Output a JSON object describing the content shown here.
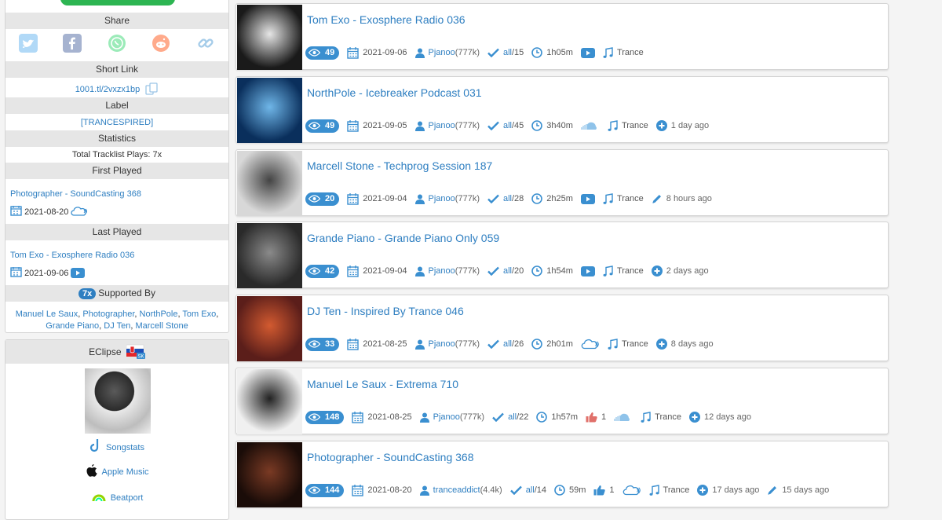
{
  "sidebar": {
    "share_title": "Share",
    "share_icons": [
      "twitter-icon",
      "facebook-icon",
      "whatsapp-icon",
      "reddit-icon",
      "link-icon"
    ],
    "short_link_title": "Short Link",
    "short_link": "1001.tl/2vxzx1bp",
    "label_title": "Label",
    "label_value": "[TRANCESPIRED]",
    "statistics_title": "Statistics",
    "total_plays": "Total Tracklist Plays: 7x",
    "first_played_title": "First Played",
    "first_played": {
      "name": "Photographer - SoundCasting 368",
      "date": "2021-08-20"
    },
    "last_played_title": "Last Played",
    "last_played": {
      "name": "Tom Exo - Exosphere Radio 036",
      "date": "2021-09-06"
    },
    "supported_badge": "7x",
    "supported_title": "Supported By",
    "supporters": [
      "Manuel Le Saux",
      "Photographer",
      "NorthPole",
      "Tom Exo",
      "Grande Piano",
      "DJ Ten",
      "Marcell Stone"
    ],
    "artist_name": "EClipse",
    "flag_badge": "SK",
    "links": [
      "Songstats",
      "Apple Music",
      "Beatport"
    ]
  },
  "tracklists": [
    {
      "title": "Tom Exo - Exosphere Radio 036",
      "views": "49",
      "date": "2021-09-06",
      "user": "Pjanoo",
      "user_count": "(777k)",
      "ids": "all",
      "ids_total": "/15",
      "duration": "1h05m",
      "media": "youtube",
      "genre": "Trance",
      "extra": "",
      "thumb": [
        "#1a1a1a",
        "#e6e6e6"
      ]
    },
    {
      "title": "NorthPole - Icebreaker Podcast 031",
      "views": "49",
      "date": "2021-09-05",
      "user": "Pjanoo",
      "user_count": "(777k)",
      "ids": "all",
      "ids_total": "/45",
      "duration": "3h40m",
      "media": "soundcloud",
      "genre": "Trance",
      "extra": "1 day ago",
      "extra_icon": "plus",
      "thumb": [
        "#0a2f5c",
        "#6fb6e8"
      ]
    },
    {
      "title": "Marcell Stone - Techprog Session 187",
      "views": "20",
      "date": "2021-09-04",
      "user": "Pjanoo",
      "user_count": "(777k)",
      "ids": "all",
      "ids_total": "/28",
      "duration": "2h25m",
      "media": "youtube",
      "genre": "Trance",
      "extra": "8 hours ago",
      "extra_icon": "pencil",
      "thumb": [
        "#d8d8d8",
        "#444444"
      ]
    },
    {
      "title": "Grande Piano - Grande Piano Only 059",
      "views": "42",
      "date": "2021-09-04",
      "user": "Pjanoo",
      "user_count": "(777k)",
      "ids": "all",
      "ids_total": "/20",
      "duration": "1h54m",
      "media": "youtube",
      "genre": "Trance",
      "extra": "2 days ago",
      "extra_icon": "plus",
      "thumb": [
        "#2a2a2a",
        "#8a8a8a"
      ]
    },
    {
      "title": "DJ Ten - Inspired By Trance 046",
      "views": "33",
      "date": "2021-08-25",
      "user": "Pjanoo",
      "user_count": "(777k)",
      "ids": "all",
      "ids_total": "/26",
      "duration": "2h01m",
      "media": "cloud",
      "genre": "Trance",
      "extra": "8 days ago",
      "extra_icon": "plus",
      "thumb": [
        "#5b1e1a",
        "#d25a30"
      ]
    },
    {
      "title": "Manuel Le Saux - Extrema 710",
      "views": "148",
      "date": "2021-08-25",
      "user": "Pjanoo",
      "user_count": "(777k)",
      "ids": "all",
      "ids_total": "/22",
      "duration": "1h57m",
      "likes": "1",
      "like_color": "#e0706a",
      "media": "soundcloud",
      "genre": "Trance",
      "extra": "12 days ago",
      "extra_icon": "plus",
      "thumb": [
        "#f0f0f0",
        "#222222"
      ]
    },
    {
      "title": "Photographer - SoundCasting 368",
      "views": "144",
      "date": "2021-08-20",
      "user": "tranceaddict",
      "user_count": "(4.4k)",
      "ids": "all",
      "ids_total": "/14",
      "duration": "59m",
      "likes": "1",
      "like_color": "#3a8fd0",
      "media": "cloud",
      "genre": "Trance",
      "extra": "17 days ago",
      "extra_icon": "plus",
      "extra2": "15 days ago",
      "thumb": [
        "#1a0c08",
        "#7a3a24"
      ]
    }
  ],
  "colors": {
    "accent": "#2f7fc1",
    "badge": "#3a8fd0",
    "green": "#2db552",
    "header_bg": "#e6e6e6"
  }
}
